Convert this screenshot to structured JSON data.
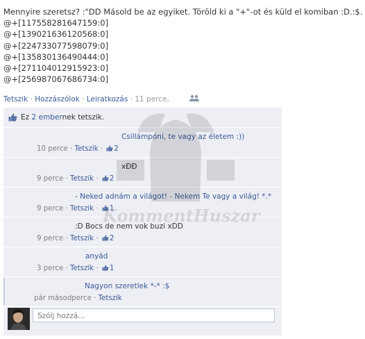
{
  "post": {
    "text": "Mennyire szeretsz? :\"DD Másold be az egyiket. Töröld ki a \"+\"-ot és küld el komiban :D.:$.",
    "lines": [
      "@+[117558281647159:0]",
      "@+[139021636120568:0]",
      "@+[224733077598079:0]",
      "@+[135830136490444:0]",
      "@+[271104012915923:0]",
      "@+[256987067686734:0]"
    ]
  },
  "actions": {
    "like": "Tetszik",
    "comment": "Hozzászólok",
    "unsubscribe": "Leiratkozás",
    "time": "11 perce",
    "sep": "·",
    "comma": ","
  },
  "likes": {
    "prefix": "Ez",
    "link": "2 ember",
    "suffix": "nek tetszik."
  },
  "comments": [
    {
      "text": "Csillámpóni, te vagy az életem :))",
      "time": "10 perce",
      "like": "Tetszik",
      "count": "2",
      "style": "link"
    },
    {
      "text": "xÐÐ",
      "time": "9 perce",
      "like": "Tetszik",
      "count": "2",
      "style": "dark"
    },
    {
      "text": "- Neked adnám a világot! - Nekem Te vagy a világ! *.*",
      "time": "9 perce",
      "like": "Tetszik",
      "count": "1",
      "style": "link"
    },
    {
      "text": ":D Bocs de nem vok buzi xDD",
      "time": "9 perce",
      "like": "Tetszik",
      "count": "2",
      "style": "dark"
    },
    {
      "text": "anyád",
      "time": "3 perce",
      "like": "Tetszik",
      "count": "1",
      "style": "link"
    },
    {
      "text": "Nagyon szeretlek *-* :$",
      "time": "pár másodperce",
      "like": "Tetszik",
      "count": "",
      "style": "link"
    }
  ],
  "write": {
    "placeholder": "Szólj hozzá..."
  },
  "watermark": {
    "text": "KommentHuszar"
  },
  "colors": {
    "link": "#3b5998",
    "feed_bg": "#edeff4",
    "meta": "#808080"
  },
  "icons": [
    "thumbs-up-icon",
    "people-icon",
    "user-avatar"
  ]
}
